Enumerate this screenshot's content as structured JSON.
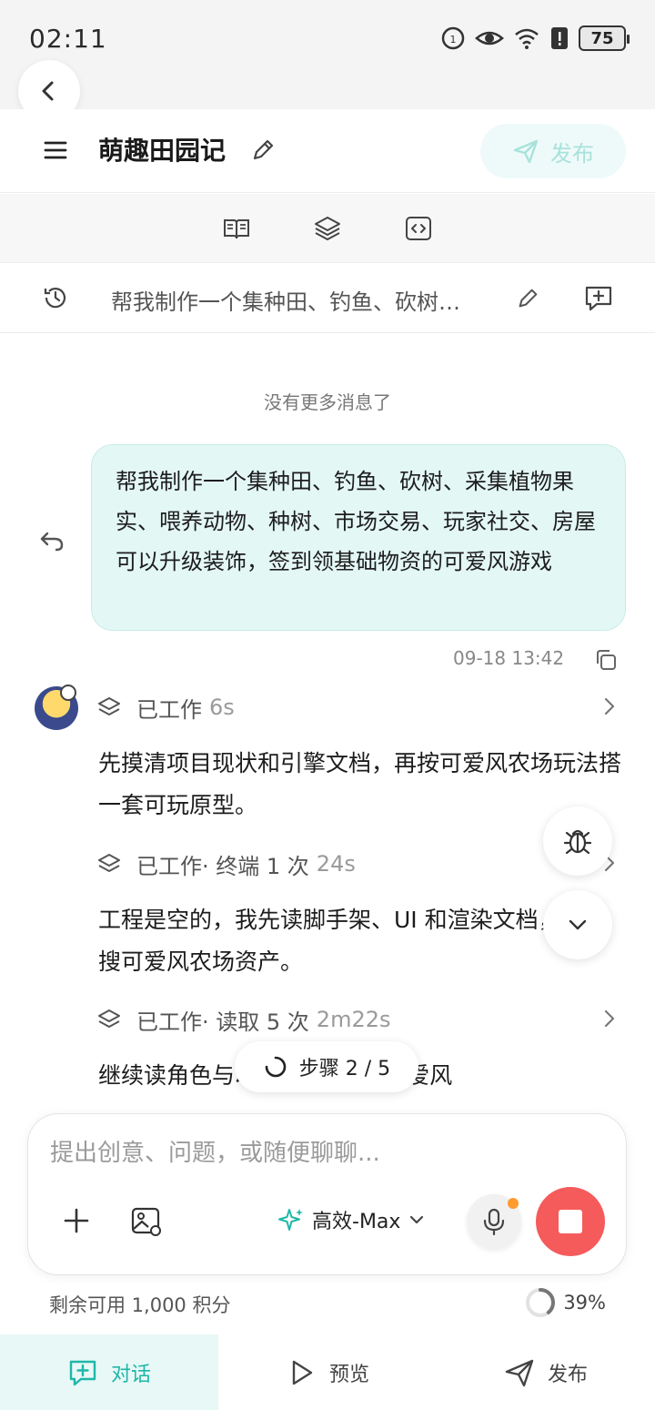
{
  "status_bar": {
    "time": "02:11",
    "battery": "75"
  },
  "header": {
    "title": "萌趣田园记",
    "publish_label": "发布"
  },
  "session": {
    "title": "帮我制作一个集种田、钓鱼、砍树…"
  },
  "chat": {
    "no_more": "没有更多消息了",
    "user_message": "帮我制作一个集种田、钓鱼、砍树、采集植物果实、喂养动物、种树、市场交易、玩家社交、房屋可以升级装饰，签到领基础物资的可爱风游戏",
    "user_time": "09-18 13:42",
    "work_steps": [
      {
        "label": "已工作",
        "detail": "",
        "duration": "6s"
      },
      {
        "label": "已工作",
        "detail": " · 终端 1 次",
        "duration": "24s"
      },
      {
        "label": "已工作",
        "detail": " · 读取 5 次",
        "duration": "2m22s"
      }
    ],
    "ai_messages": [
      "先摸清项目现状和引擎文档，再按可爱风农场玩法搭一套可玩原型。",
      "工程是空的，我先读脚手架、UI 和渲染文档，同时搜可爱风农场资产。",
      "继续读角色与动画、HUD 和可爱风"
    ],
    "step_indicator": "步骤 2 / 5"
  },
  "composer": {
    "placeholder": "提出创意、问题，或随便聊聊...",
    "model": "高效-Max"
  },
  "footer": {
    "credits": "剩余可用 1,000 积分",
    "progress": "39%",
    "progress_value": 0.39
  },
  "bottom_nav": [
    {
      "label": "对话",
      "active": true
    },
    {
      "label": "预览",
      "active": false
    },
    {
      "label": "发布",
      "active": false
    }
  ],
  "colors": {
    "accent": "#1fb7a9",
    "user_bubble": "#e3f7f5",
    "stop": "#f55b5b"
  }
}
